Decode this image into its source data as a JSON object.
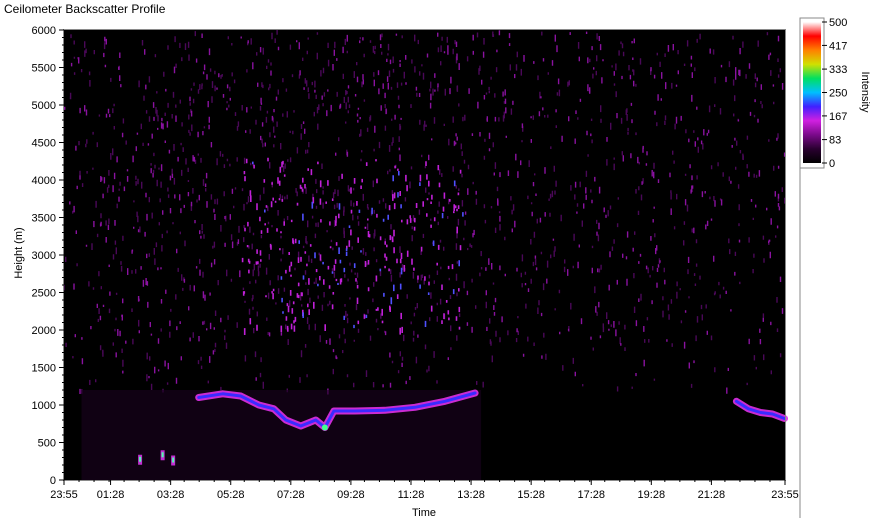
{
  "window": {
    "title": "Ceilometer Backscatter Profile"
  },
  "chart_data": {
    "type": "heatmap",
    "xlabel": "Time",
    "ylabel": "Height (m)",
    "x_ticks": [
      "23:55",
      "01:28",
      "03:28",
      "05:28",
      "07:28",
      "09:28",
      "11:28",
      "13:28",
      "15:28",
      "17:28",
      "19:28",
      "21:28",
      "23:55"
    ],
    "x_tick_hours": [
      -0.0833,
      1.4667,
      3.4667,
      5.4667,
      7.4667,
      9.4667,
      11.4667,
      13.4667,
      15.4667,
      17.4667,
      19.4667,
      21.4667,
      23.9167
    ],
    "y_ticks": [
      0,
      500,
      1000,
      1500,
      2000,
      2500,
      3000,
      3500,
      4000,
      4500,
      5000,
      5500,
      6000
    ],
    "ylim": [
      0,
      6000
    ],
    "colorbar": {
      "label": "Intensity",
      "ticks": [
        "500",
        "417",
        "333",
        "250",
        "167",
        "83",
        "0"
      ],
      "range": [
        0,
        500
      ],
      "colors": [
        "#000000",
        "#2a0030",
        "#7a0a8a",
        "#d020e0",
        "#4020ff",
        "#00c0ff",
        "#00e060",
        "#d0e000",
        "#ff8000",
        "#ff0000",
        "#ffffff"
      ]
    },
    "features": {
      "noise_band_height": [
        1200,
        6000
      ],
      "enhanced_region": {
        "time_hours": [
          5.8,
          13.2
        ],
        "height": [
          2000,
          4300
        ]
      },
      "cloud_base_layer": [
        {
          "t": 4.4,
          "h": 1100
        },
        {
          "t": 5.2,
          "h": 1150
        },
        {
          "t": 5.8,
          "h": 1120
        },
        {
          "t": 6.4,
          "h": 1000
        },
        {
          "t": 6.9,
          "h": 950
        },
        {
          "t": 7.3,
          "h": 800
        },
        {
          "t": 7.8,
          "h": 720
        },
        {
          "t": 8.3,
          "h": 800
        },
        {
          "t": 8.6,
          "h": 700
        },
        {
          "t": 8.9,
          "h": 920
        },
        {
          "t": 9.6,
          "h": 920
        },
        {
          "t": 10.6,
          "h": 930
        },
        {
          "t": 11.6,
          "h": 970
        },
        {
          "t": 12.6,
          "h": 1050
        },
        {
          "t": 13.6,
          "h": 1160
        }
      ],
      "late_layer": [
        {
          "t": 22.3,
          "h": 1050
        },
        {
          "t": 22.7,
          "h": 950
        },
        {
          "t": 23.1,
          "h": 900
        },
        {
          "t": 23.5,
          "h": 880
        },
        {
          "t": 23.9,
          "h": 820
        }
      ],
      "low_spots": [
        {
          "t": 2.45,
          "h": 270
        },
        {
          "t": 3.2,
          "h": 330
        },
        {
          "t": 3.55,
          "h": 260
        }
      ]
    }
  }
}
